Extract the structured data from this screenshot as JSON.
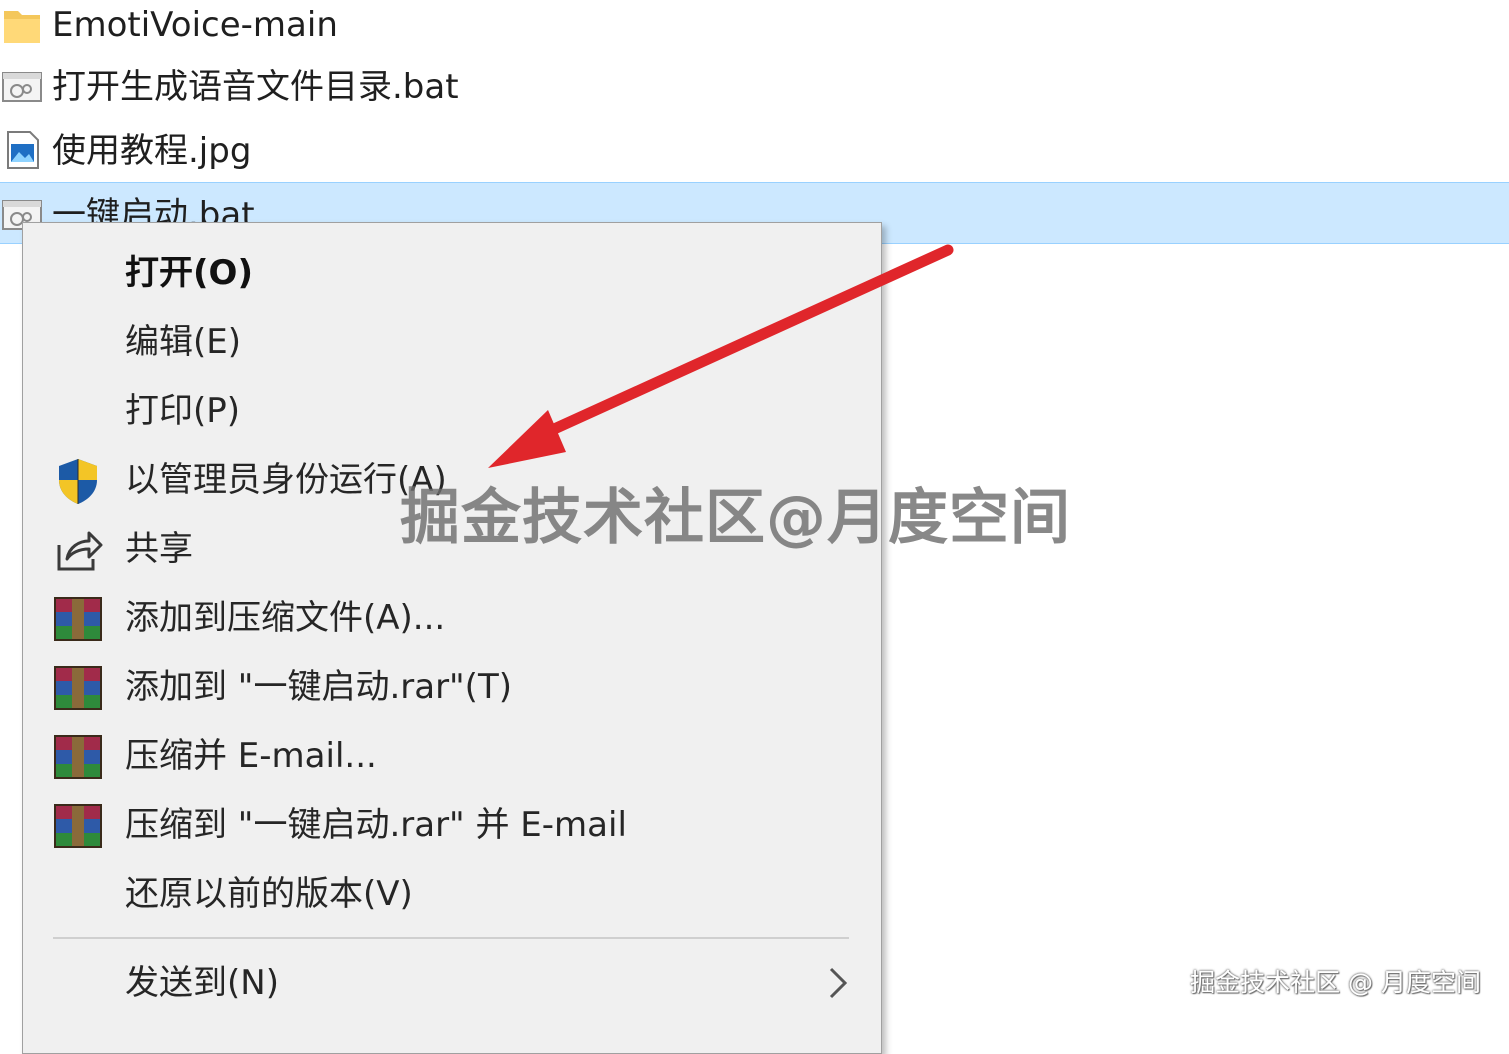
{
  "files": [
    {
      "name": "EmotiVoice-main",
      "icon": "folder-icon"
    },
    {
      "name": "打开生成语音文件目录.bat",
      "icon": "batch-file-icon"
    },
    {
      "name": "使用教程.jpg",
      "icon": "image-file-icon"
    },
    {
      "name": "一键启动.bat",
      "icon": "batch-file-icon",
      "selected": true
    }
  ],
  "context_menu": {
    "items": [
      {
        "label": "打开(O)",
        "icon": null,
        "default": true
      },
      {
        "label": "编辑(E)",
        "icon": null
      },
      {
        "label": "打印(P)",
        "icon": null
      },
      {
        "label": "以管理员身份运行(A)",
        "icon": "uac-shield-icon"
      },
      {
        "label": "共享",
        "icon": "share-icon"
      },
      {
        "label": "添加到压缩文件(A)...",
        "icon": "winrar-icon"
      },
      {
        "label": "添加到 \"一键启动.rar\"(T)",
        "icon": "winrar-icon"
      },
      {
        "label": "压缩并 E-mail...",
        "icon": "winrar-icon"
      },
      {
        "label": "压缩到 \"一键启动.rar\" 并 E-mail",
        "icon": "winrar-icon"
      },
      {
        "label": "还原以前的版本(V)",
        "icon": null
      },
      {
        "label": "发送到(N)",
        "icon": null,
        "submenu": true
      }
    ]
  },
  "annotation": {
    "arrow_color": "#e0262b",
    "points_to": "以管理员身份运行(A)"
  },
  "watermarks": {
    "center": "掘金技术社区@月度空间",
    "corner": "掘金技术社区 @ 月度空间"
  },
  "colors": {
    "selection_bg": "#cce8ff",
    "menu_bg": "#f0f0f0",
    "arrow": "#e0262b"
  }
}
